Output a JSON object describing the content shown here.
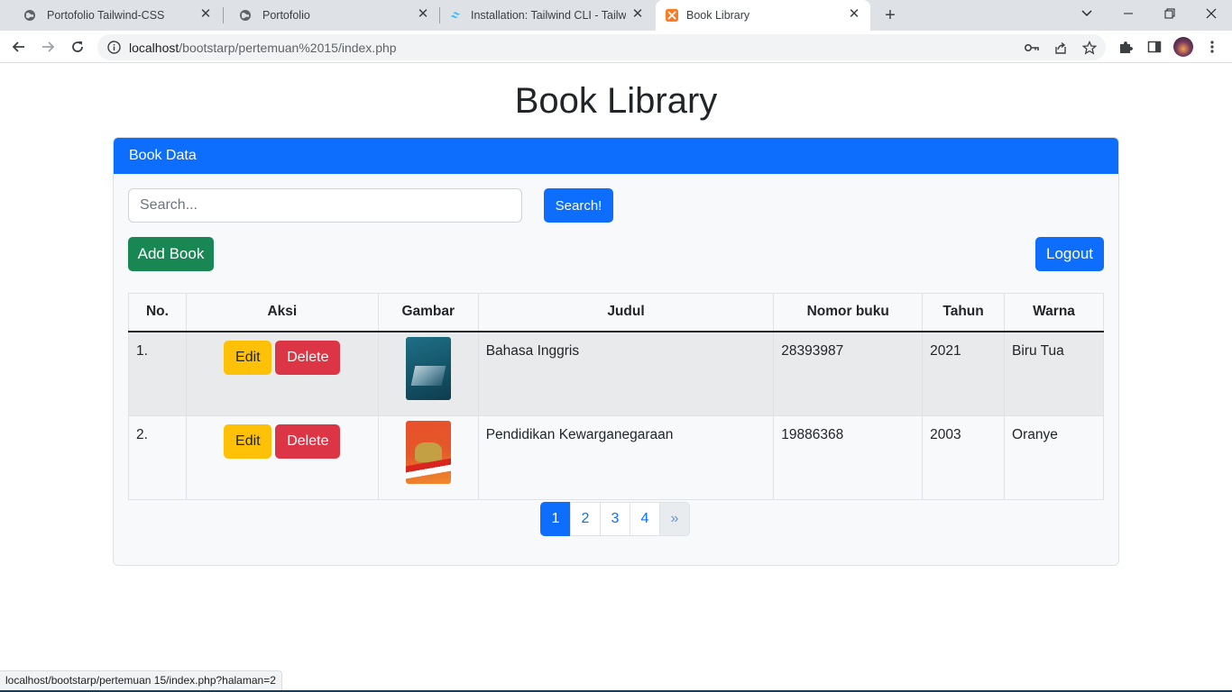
{
  "browser": {
    "tabs": [
      {
        "title": "Portofolio Tailwind-CSS",
        "icon": "globe-icon"
      },
      {
        "title": "Portofolio",
        "icon": "globe-icon"
      },
      {
        "title": "Installation: Tailwind CLI - Tailwind",
        "icon": "tailwind-icon"
      },
      {
        "title": "Book Library",
        "icon": "xampp-icon",
        "active": true
      }
    ],
    "close_glyph": "✕",
    "new_tab_glyph": "+",
    "url_host": "localhost",
    "url_path": "/bootstarp/pertemuan%2015/index.php",
    "status_url": "localhost/bootstarp/pertemuan 15/index.php?halaman=2"
  },
  "page": {
    "title": "Book Library"
  },
  "card": {
    "header": "Book Data",
    "search_placeholder": "Search...",
    "search_label": "Search!",
    "add_label": "Add Book",
    "logout_label": "Logout"
  },
  "table": {
    "headers": [
      "No.",
      "Aksi",
      "Gambar",
      "Judul",
      "Nomor buku",
      "Tahun",
      "Warna"
    ],
    "edit_label": "Edit",
    "delete_label": "Delete",
    "rows": [
      {
        "no": "1.",
        "judul": "Bahasa Inggris",
        "nomor": "28393987",
        "tahun": "2021",
        "warna": "Biru Tua",
        "cover_color": "#1f6f86"
      },
      {
        "no": "2.",
        "judul": "Pendidikan Kewarganegaraan",
        "nomor": "19886368",
        "tahun": "2003",
        "warna": "Oranye",
        "cover_color": "#e8502a"
      }
    ]
  },
  "pagination": {
    "pages": [
      "1",
      "2",
      "3",
      "4"
    ],
    "active_page": "1",
    "next_label": "»"
  },
  "colors": {
    "primary": "#0d6efd",
    "success": "#198754",
    "warning": "#ffc107",
    "danger": "#dc3545"
  }
}
